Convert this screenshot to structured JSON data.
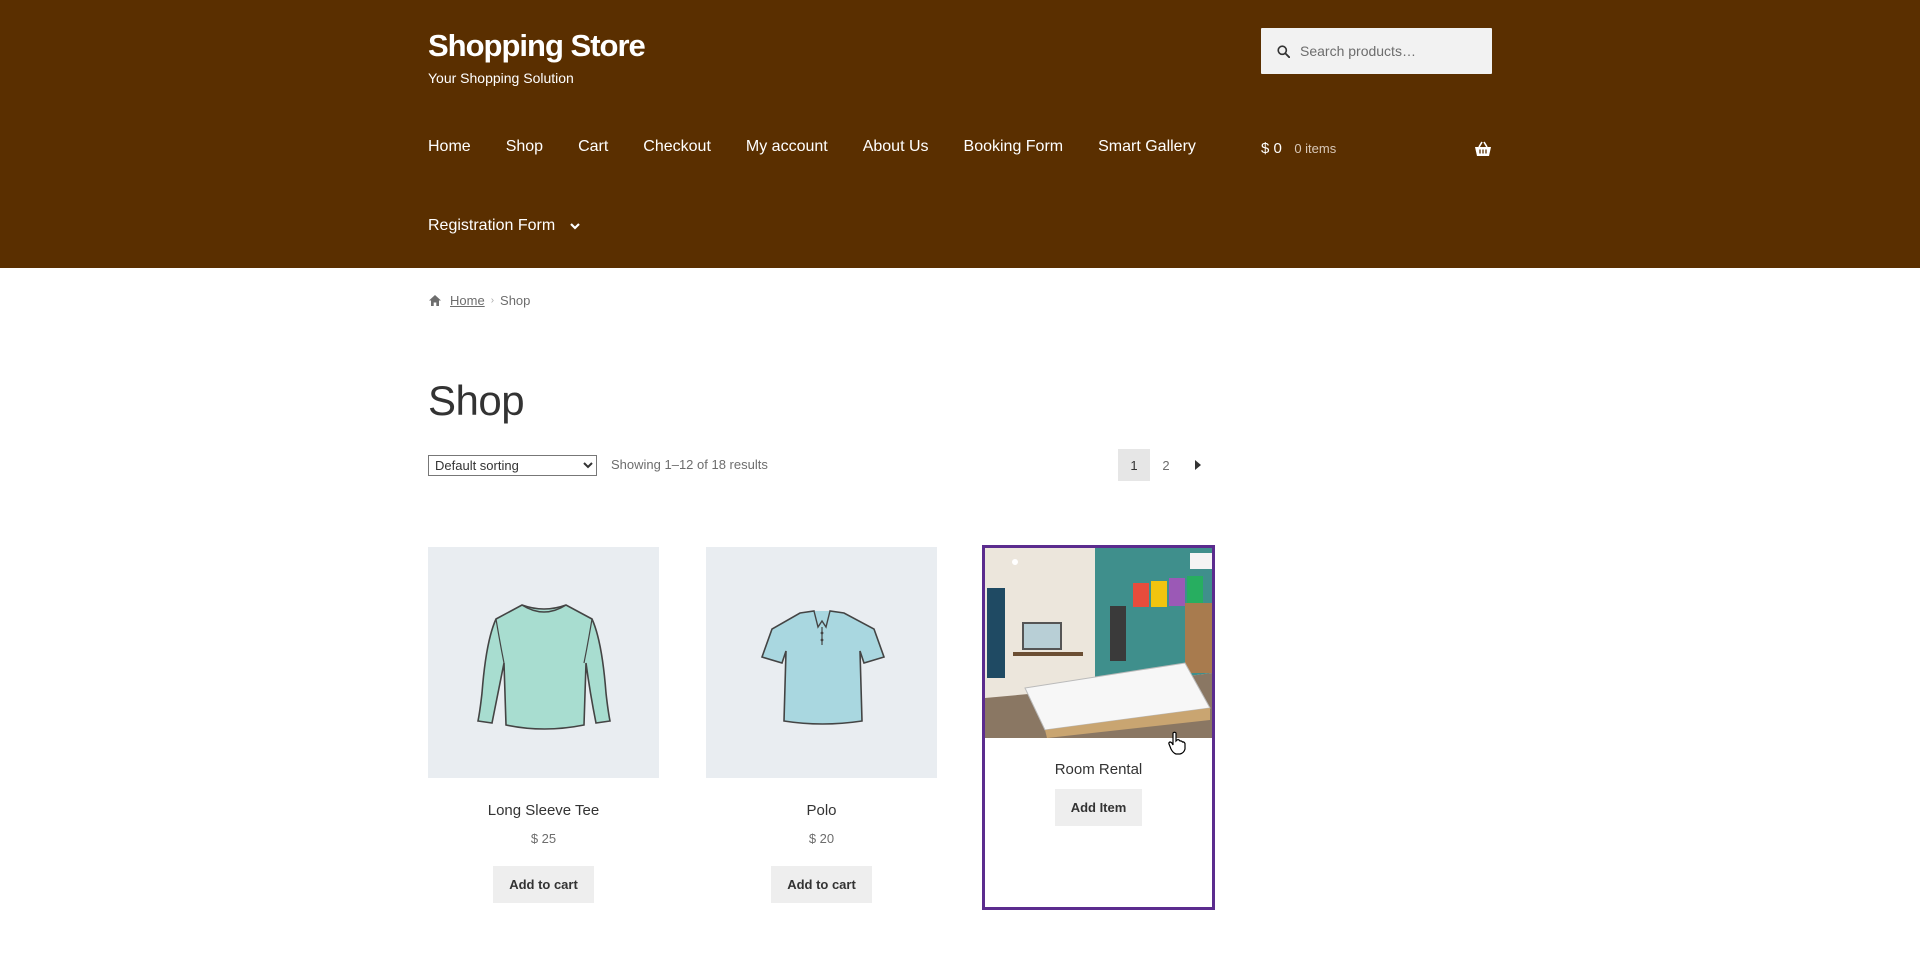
{
  "header": {
    "site_title": "Shopping Store",
    "tagline": "Your Shopping Solution",
    "search_placeholder": "Search products…",
    "nav": [
      "Home",
      "Shop",
      "Cart",
      "Checkout",
      "My account",
      "About Us",
      "Booking Form",
      "Smart Gallery"
    ],
    "nav_row2": "Registration Form",
    "cart": {
      "amount": "$ 0",
      "items": "0 items"
    },
    "bg_color": "#5a2f00"
  },
  "breadcrumb": {
    "home": "Home",
    "current": "Shop"
  },
  "page_title": "Shop",
  "toolbar": {
    "sort_selected": "Default sorting",
    "result_count": "Showing 1–12 of 18 results",
    "pages": [
      "1",
      "2"
    ]
  },
  "products": [
    {
      "name": "Long Sleeve Tee",
      "price": "$ 25",
      "button": "Add to cart"
    },
    {
      "name": "Polo",
      "price": "$ 20",
      "button": "Add to cart"
    },
    {
      "name": "Room Rental",
      "button": "Add Item"
    }
  ],
  "icons": {
    "search": "search-icon",
    "basket": "basket-icon",
    "home": "home-icon",
    "chevron": "chevron-down-icon",
    "next": "arrow-right-icon"
  },
  "colors": {
    "highlight_border": "#5b2c8e",
    "button_bg": "#eeeeee"
  }
}
